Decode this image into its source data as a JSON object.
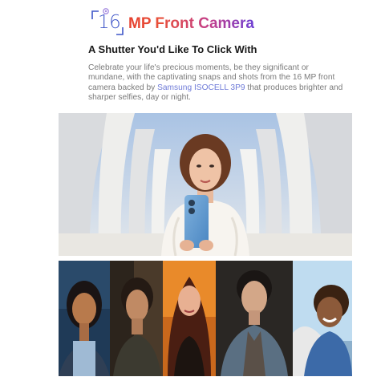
{
  "header": {
    "badge_number": "16",
    "title": "MP Front Camera"
  },
  "subheading": "A Shutter You'd Like To Click With",
  "description": {
    "before": "Celebrate your life's precious moments, be they significant or mundane, with the captivating snaps and shots from the 16 MP front camera backed by ",
    "highlight": "Samsung ISOCELL 3P9",
    "after": " that produces brighter and sharper selfies, day or night."
  },
  "colors": {
    "badge_blue": "#3f56c8",
    "title_start": "#e6402e",
    "title_end": "#6c3fd4",
    "highlight": "#6f7bd8",
    "body_text": "#7a7a7a"
  },
  "icons": {
    "badge": "camera-frame-icon",
    "phone": "phone-icon"
  }
}
